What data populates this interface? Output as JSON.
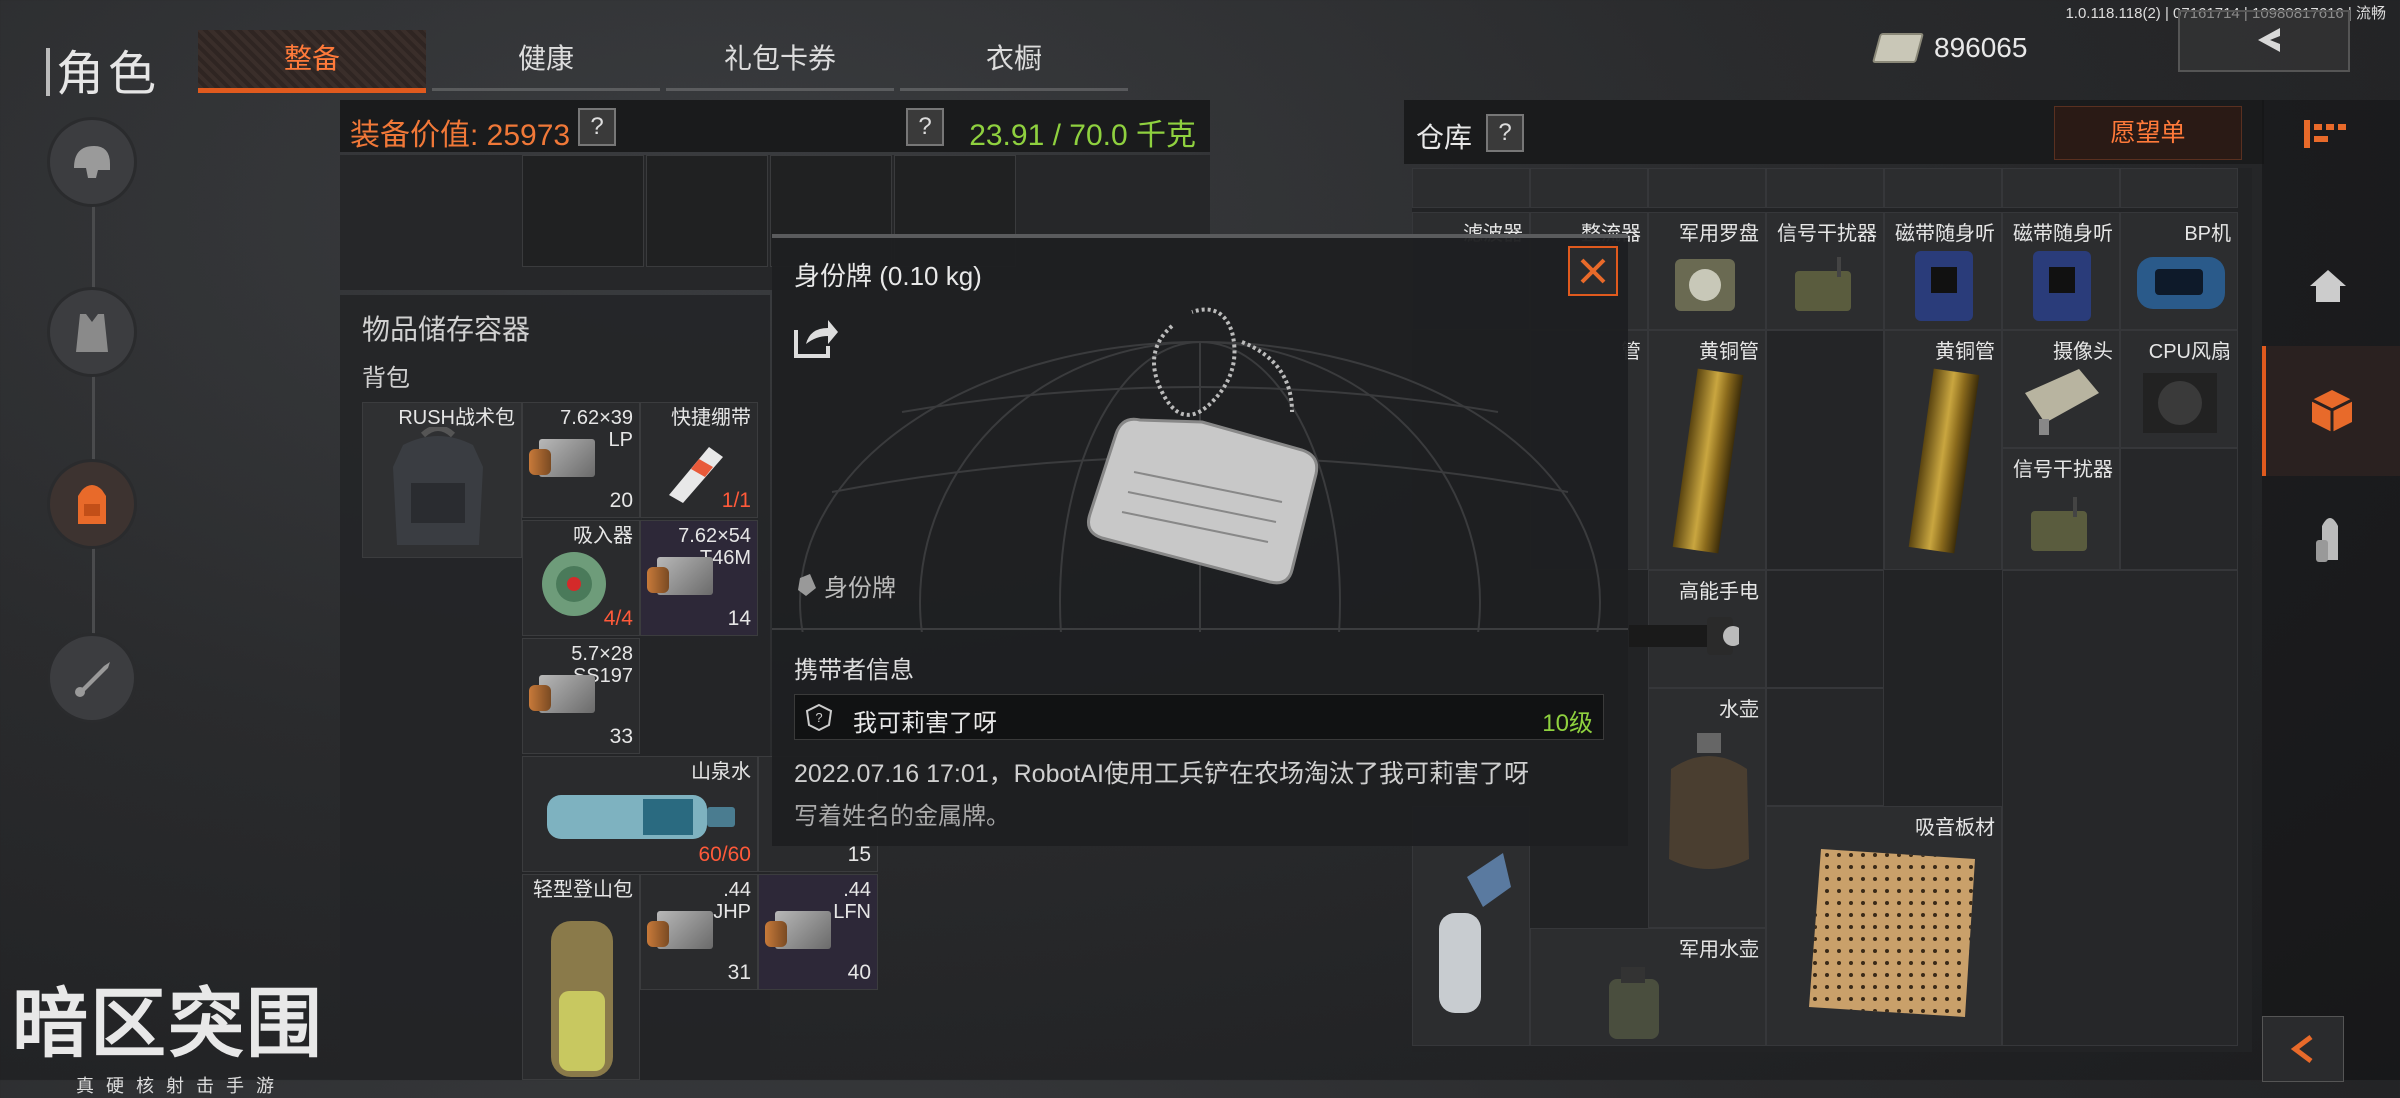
{
  "version": "1.0.118.118(2) | 07161714 | 10980817616 | 流畅",
  "header": {
    "title": "角色",
    "tabs": [
      {
        "label": "整备",
        "active": true
      },
      {
        "label": "健康",
        "active": false
      },
      {
        "label": "礼包卡券",
        "active": false
      },
      {
        "label": "衣橱",
        "active": false
      }
    ],
    "currency": "896065"
  },
  "left_rail": {
    "icons": [
      "helmet-icon",
      "vest-icon",
      "backpack-icon",
      "tools-icon"
    ],
    "active_index": 2
  },
  "equipment": {
    "value_label": "装备价值: 25973",
    "help": "?",
    "weight": "23.91 / 70.0 千克"
  },
  "storage": {
    "title": "物品储存容器",
    "backpack_label": "背包",
    "items": [
      {
        "name": "RUSH战术包",
        "count": ""
      },
      {
        "name": "7.62×39\nLP",
        "count": "20"
      },
      {
        "name": "快捷绷带",
        "count": "1/1",
        "red": true
      },
      {
        "name": "吸入器",
        "count": "4/4",
        "red": true
      },
      {
        "name": "7.62×54\nT46M",
        "count": "14"
      },
      {
        "name": "5.7×28\nSS197",
        "count": "33"
      },
      {
        "name": "山泉水",
        "count": "60/60",
        "red": true
      },
      {
        "name": "",
        "count": "15"
      },
      {
        "name": "轻型登山包",
        "count": ""
      },
      {
        "name": ".44\nJHP",
        "count": "31"
      },
      {
        "name": ".44\nLFN",
        "count": "40"
      }
    ]
  },
  "popup": {
    "title": "身份牌 (0.10 kg)",
    "item_name": "身份牌",
    "owner_label": "携带者信息",
    "owner_name": "我可莉害了呀",
    "owner_level": "10级",
    "event": "2022.07.16 17:01，RobotAI使用工兵铲在农场淘汰了我可莉害了呀",
    "description": "写着姓名的金属牌。"
  },
  "warehouse": {
    "title": "仓库",
    "help": "?",
    "wishlist": "愿望单",
    "items": [
      {
        "name": "滤波器"
      },
      {
        "name": "整流器"
      },
      {
        "name": "军用罗盘"
      },
      {
        "name": "信号干扰器"
      },
      {
        "name": "磁带随身听"
      },
      {
        "name": "磁带随身听"
      },
      {
        "name": "BP机"
      },
      {
        "name": "管"
      },
      {
        "name": "黄铜管"
      },
      {
        "name": "黄铜管"
      },
      {
        "name": "摄像头"
      },
      {
        "name": "CPU风扇"
      },
      {
        "name": "信号干扰器"
      },
      {
        "name": "高能手电"
      },
      {
        "name": "水壶"
      },
      {
        "name": "吸音板材"
      },
      {
        "name": "军用水壶"
      }
    ]
  },
  "right_rail": {
    "icons": [
      "home-icon",
      "stash-icon",
      "ammo-icon"
    ],
    "active_index": 1
  },
  "logo": {
    "text": "暗区突围",
    "subtitle": "真硬核射击手游"
  },
  "colors": {
    "accent": "#e05a1e",
    "value_orange": "#f07838",
    "weight_green": "#8fd13f"
  }
}
